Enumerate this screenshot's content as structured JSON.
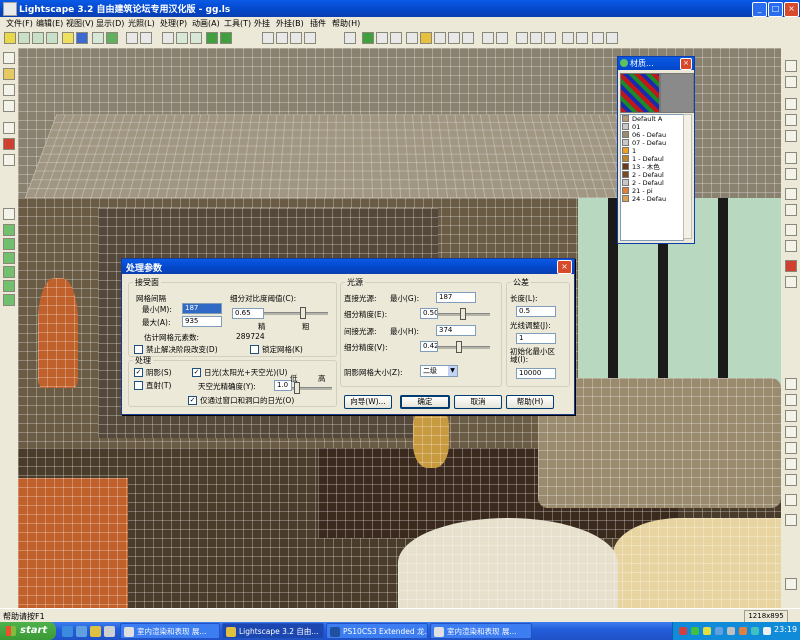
{
  "window": {
    "title": "Lightscape 3.2 自由建筑论坛专用汉化版 - gg.ls",
    "controls": {
      "minimize": "_",
      "maximize": "□",
      "close": "×"
    }
  },
  "menu": [
    "文件(F)",
    "编辑(E)",
    "视图(V)",
    "显示(D)",
    "光照(L)",
    "处理(P)",
    "动画(A)",
    "工具(T)",
    "外挂",
    "外挂(B)",
    "插件",
    "帮助(H)"
  ],
  "material_window": {
    "title": "材质...",
    "close": "×",
    "items": [
      {
        "label": "Default A",
        "color": "#b59a70"
      },
      {
        "label": "01",
        "color": "#c8c8c8"
      },
      {
        "label": "06 - Defau",
        "color": "#9a8a70"
      },
      {
        "label": "07 - Defau",
        "color": "#c8c8c8"
      },
      {
        "label": "1",
        "color": "#f0a020"
      },
      {
        "label": "1 - Defaul",
        "color": "#c0842a"
      },
      {
        "label": "13 - 木色",
        "color": "#6a3a1a"
      },
      {
        "label": "2 - Defaul",
        "color": "#7a4a20"
      },
      {
        "label": "2 - Defaul",
        "color": "#c8c8c8"
      },
      {
        "label": "21 - pi",
        "color": "#e0803a"
      },
      {
        "label": "24 - Defau",
        "color": "#d8a050"
      }
    ]
  },
  "dialog": {
    "title": "处理参数",
    "close": "×",
    "receiving_surfaces": {
      "legend": "接受面",
      "mesh_spacing": "网格间隔",
      "min_label": "最小(M):",
      "min_value": "187",
      "max_label": "最大(A):",
      "max_value": "935",
      "subdiv_label": "细分对比度阈值(C):",
      "subdiv_value": "0.65",
      "precise": "精",
      "coarse": "粗",
      "estimate_label": "估计网格元素数:",
      "estimate_value": "289724",
      "disable_change": "禁止解决阶段改变(D)",
      "lock_mesh": "锁定网格(K)"
    },
    "processing": {
      "legend": "处理",
      "shadow": "阴影(S)",
      "shadow_checked": true,
      "sunlight": "日光(太阳光+天空光)(U)",
      "sunlight_checked": true,
      "direct": "直射(T)",
      "direct_checked": false,
      "sky_precision": "天空光精确度(Y):",
      "sky_value": "1.0",
      "low": "低",
      "high": "高",
      "window_only": "仅通过窗口和洞口的日光(O)",
      "window_only_checked": true
    },
    "light_sources": {
      "legend": "光源",
      "direct_label": "直接光源:",
      "direct_min": "最小(G):",
      "direct_min_value": "187",
      "direct_subdiv": "细分精度(E):",
      "direct_subdiv_value": "0.50",
      "indirect_label": "间接光源:",
      "indirect_min": "最小(H):",
      "indirect_min_value": "374",
      "indirect_subdiv": "细分精度(V):",
      "indirect_subdiv_value": "0.42",
      "shadow_grid": "阴影网格大小(Z):",
      "shadow_grid_value": "二级"
    },
    "tolerance": {
      "legend": "公差",
      "length": "长度(L):",
      "length_value": "0.5",
      "lighting_adjust": "光线调整(J):",
      "lighting_value": "1",
      "init_min_area": "初始化最小区域(I):",
      "init_min_area_value": "10000"
    },
    "buttons": {
      "wizard": "向导(W)...",
      "ok": "确定",
      "cancel": "取消",
      "help": "帮助(H)"
    }
  },
  "status": {
    "text": "帮助请按F1",
    "dims": "1218x895"
  },
  "taskbar": {
    "start": "start",
    "tasks": [
      "室内渲染和表现 展...",
      "Lightscape 3.2 自由...",
      "PS10CS3 Extended 龙...",
      "室内渲染和表现 展..."
    ],
    "active_index": 1,
    "clock": "23:19"
  }
}
